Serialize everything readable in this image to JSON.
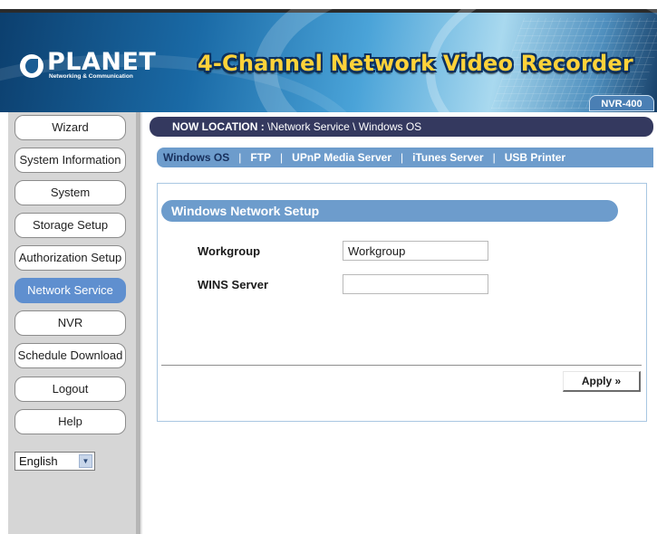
{
  "header": {
    "logo_name": "PLANET",
    "logo_subtitle": "Networking & Communication",
    "title": "4-Channel Network Video Recorder",
    "model": "NVR-400"
  },
  "sidebar": {
    "items": [
      {
        "label": "Wizard",
        "active": false
      },
      {
        "label": "System Information",
        "active": false
      },
      {
        "label": "System",
        "active": false
      },
      {
        "label": "Storage Setup",
        "active": false
      },
      {
        "label": "Authorization Setup",
        "active": false
      },
      {
        "label": "Network Service",
        "active": true
      },
      {
        "label": "NVR",
        "active": false
      },
      {
        "label": "Schedule Download",
        "active": false
      },
      {
        "label": "Logout",
        "active": false
      },
      {
        "label": "Help",
        "active": false
      }
    ],
    "language": {
      "selected": "English"
    }
  },
  "location": {
    "prefix": "NOW LOCATION :",
    "path": "\\Network Service \\ Windows OS"
  },
  "tabs": [
    {
      "label": "Windows OS",
      "active": true
    },
    {
      "label": "FTP",
      "active": false
    },
    {
      "label": "UPnP Media Server",
      "active": false
    },
    {
      "label": "iTunes Server",
      "active": false
    },
    {
      "label": "USB Printer",
      "active": false
    }
  ],
  "tab_separator": "|",
  "panel": {
    "title": "Windows Network Setup",
    "fields": {
      "workgroup": {
        "label": "Workgroup",
        "value": "Workgroup"
      },
      "wins": {
        "label": "WINS Server",
        "value": ""
      }
    },
    "apply_label": "Apply »"
  },
  "colors": {
    "active_nav": "#5f8fcf",
    "location_bar": "#34395f",
    "tab_bar": "#6d9ccc",
    "title_yellow": "#ffd23a"
  }
}
